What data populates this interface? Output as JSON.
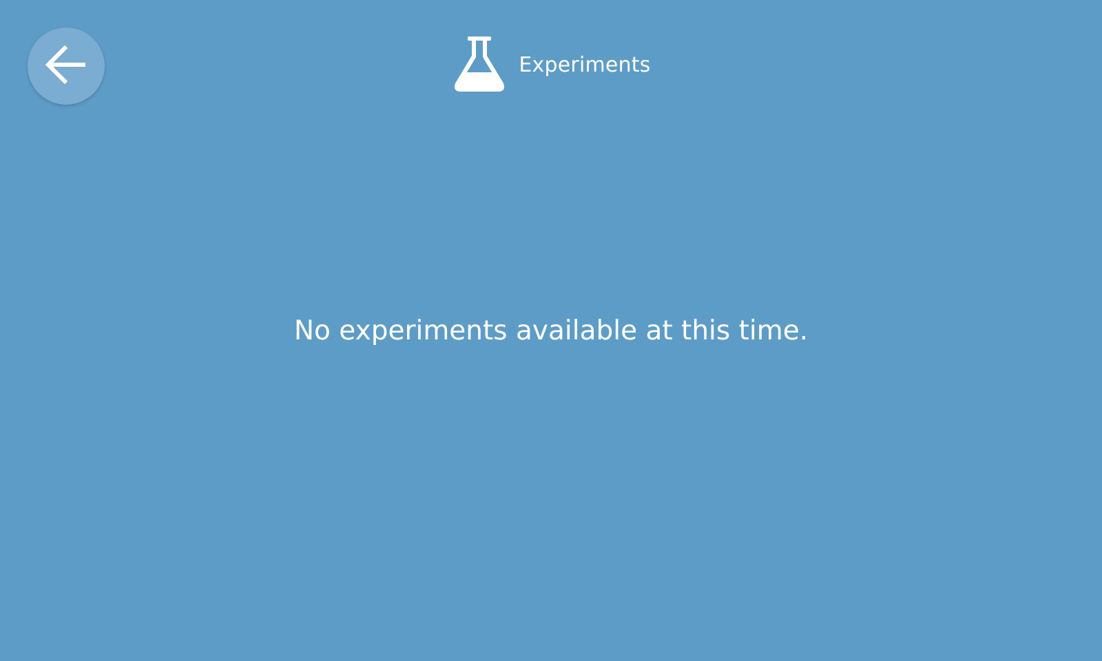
{
  "header": {
    "title": "Experiments",
    "icon": "flask-icon"
  },
  "back_button": {
    "icon": "arrow-left-icon"
  },
  "main": {
    "empty_message": "No experiments available at this time."
  },
  "colors": {
    "background": "#5d9cc7",
    "foreground": "#ffffff"
  }
}
